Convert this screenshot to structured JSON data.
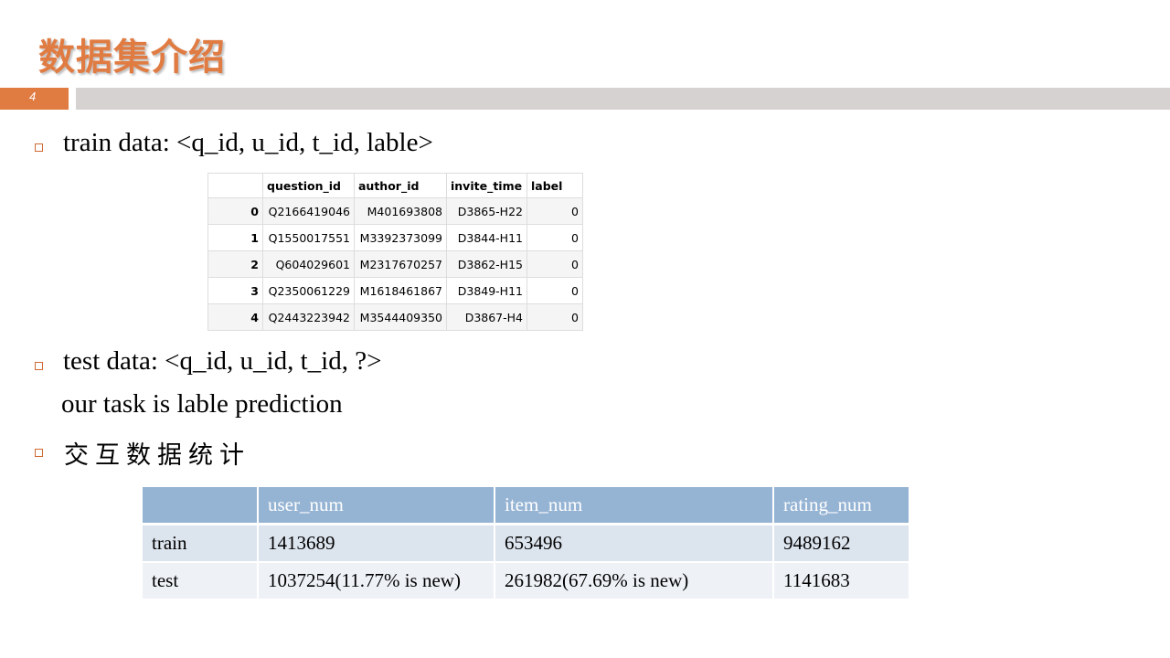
{
  "slide": {
    "title": "数据集介绍",
    "page_number": "4",
    "accent_color": "#e07b42",
    "bar_color": "#d6d2d2"
  },
  "bullets": {
    "train": "train data: <q_id, u_id, t_id, lable>",
    "test": "test data: <q_id, u_id, t_id, ?>",
    "task": "our task is lable prediction",
    "stats": "交互数据统计"
  },
  "train_table": {
    "columns": [
      "",
      "question_id",
      "author_id",
      "invite_time",
      "label"
    ],
    "rows": [
      {
        "index": "0",
        "question_id": "Q2166419046",
        "author_id": "M401693808",
        "invite_time": "D3865-H22",
        "label": "0"
      },
      {
        "index": "1",
        "question_id": "Q1550017551",
        "author_id": "M3392373099",
        "invite_time": "D3844-H11",
        "label": "0"
      },
      {
        "index": "2",
        "question_id": "Q604029601",
        "author_id": "M2317670257",
        "invite_time": "D3862-H15",
        "label": "0"
      },
      {
        "index": "3",
        "question_id": "Q2350061229",
        "author_id": "M1618461867",
        "invite_time": "D3849-H11",
        "label": "0"
      },
      {
        "index": "4",
        "question_id": "Q2443223942",
        "author_id": "M3544409350",
        "invite_time": "D3867-H4",
        "label": "0"
      }
    ]
  },
  "stats_table": {
    "columns": [
      "",
      "user_num",
      "item_num",
      "rating_num"
    ],
    "header_color": "#95b3d3",
    "rows": [
      {
        "name": "train",
        "user_num": "1413689",
        "item_num": "653496",
        "rating_num": "9489162"
      },
      {
        "name": "test",
        "user_num": "1037254(11.77% is new)",
        "item_num": "261982(67.69% is new)",
        "rating_num": "1141683"
      }
    ]
  }
}
